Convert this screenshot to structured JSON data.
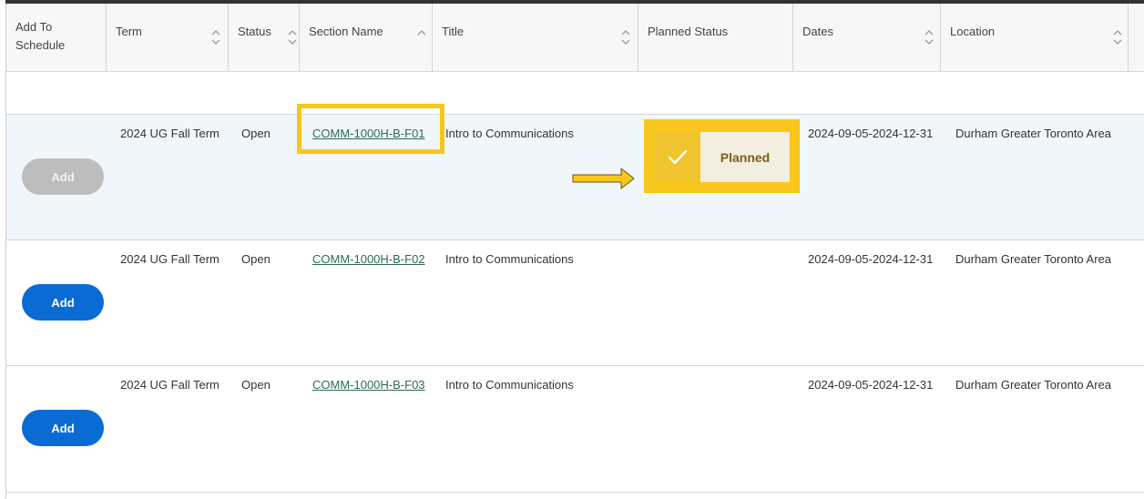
{
  "columns": [
    {
      "label_line1": "Add To",
      "label_line2": "Schedule"
    },
    {
      "label": "Term"
    },
    {
      "label": "Status"
    },
    {
      "label": "Section Name"
    },
    {
      "label": "Title"
    },
    {
      "label": "Planned Status"
    },
    {
      "label": "Dates"
    },
    {
      "label": "Location"
    }
  ],
  "rows": [
    {
      "button": "Add",
      "term": "2024 UG Fall Term",
      "status": "Open",
      "section": "COMM-1000H-B-F01",
      "title": "Intro to Communications",
      "planned": "Planned",
      "dates": "2024-09-05-2024-12-31",
      "location": "Durham Greater Toronto Area"
    },
    {
      "button": "Add",
      "term": "2024 UG Fall Term",
      "status": "Open",
      "section": "COMM-1000H-B-F02",
      "title": "Intro to Communications",
      "dates": "2024-09-05-2024-12-31",
      "location": "Durham Greater Toronto Area"
    },
    {
      "button": "Add",
      "term": "2024 UG Fall Term",
      "status": "Open",
      "section": "COMM-1000H-B-F03",
      "title": "Intro to Communications",
      "dates": "2024-09-05-2024-12-31",
      "location": "Durham Greater Toronto Area"
    }
  ],
  "colors": {
    "highlight": "#f8c61c",
    "button_blue": "#0a6bd4",
    "button_disabled": "#bdbdbd",
    "link": "#2c6a55"
  },
  "icons": {
    "sort": "sort-chevrons-icon",
    "planned": "checkmark-icon",
    "annotation": "right-arrow-icon"
  }
}
